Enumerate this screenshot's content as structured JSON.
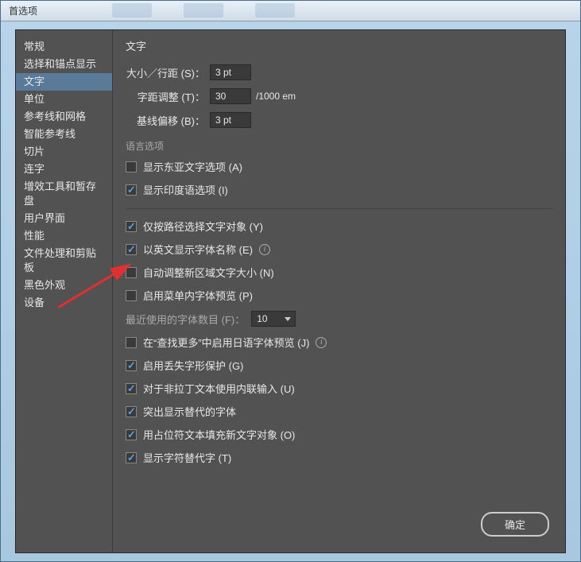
{
  "window": {
    "title": "首选项"
  },
  "sidebar": {
    "items": [
      {
        "label": "常规"
      },
      {
        "label": "选择和锚点显示"
      },
      {
        "label": "文字"
      },
      {
        "label": "单位"
      },
      {
        "label": "参考线和网格"
      },
      {
        "label": "智能参考线"
      },
      {
        "label": "切片"
      },
      {
        "label": "连字"
      },
      {
        "label": "增效工具和暂存盘"
      },
      {
        "label": "用户界面"
      },
      {
        "label": "性能"
      },
      {
        "label": "文件处理和剪贴板"
      },
      {
        "label": "黑色外观"
      },
      {
        "label": "设备"
      }
    ],
    "selected_index": 2
  },
  "main": {
    "title": "文字",
    "size_leading": {
      "label": "大小／行距 (S)：",
      "value": "3 pt"
    },
    "tracking": {
      "label": "字距调整 (T)：",
      "value": "30",
      "unit": "/1000 em"
    },
    "baseline": {
      "label": "基线偏移 (B)：",
      "value": "3 pt"
    },
    "lang_title": "语言选项",
    "lang_opts": [
      {
        "label": "显示东亚文字选项 (A)",
        "checked": false
      },
      {
        "label": "显示印度语选项 (I)",
        "checked": true
      }
    ],
    "opts_a": [
      {
        "label": "仅按路径选择文字对象 (Y)",
        "checked": true,
        "info": false
      },
      {
        "label": "以英文显示字体名称 (E)",
        "checked": true,
        "info": true
      },
      {
        "label": "自动调整新区域文字大小 (N)",
        "checked": false,
        "info": false
      },
      {
        "label": "启用菜单内字体预览 (P)",
        "checked": false,
        "info": false
      }
    ],
    "recent_fonts": {
      "label": "最近使用的字体数目 (F)：",
      "value": "10"
    },
    "opts_b": [
      {
        "label": "在“查找更多”中启用日语字体预览 (J)",
        "checked": false,
        "info": true
      },
      {
        "label": "启用丢失字形保护 (G)",
        "checked": true,
        "info": false
      },
      {
        "label": "对于非拉丁文本使用内联输入 (U)",
        "checked": true,
        "info": false
      },
      {
        "label": "突出显示替代的字体",
        "checked": true,
        "info": false
      },
      {
        "label": "用占位符文本填充新文字对象 (O)",
        "checked": true,
        "info": false
      },
      {
        "label": "显示字符替代字 (T)",
        "checked": true,
        "info": false
      }
    ]
  },
  "buttons": {
    "ok": "确定"
  }
}
